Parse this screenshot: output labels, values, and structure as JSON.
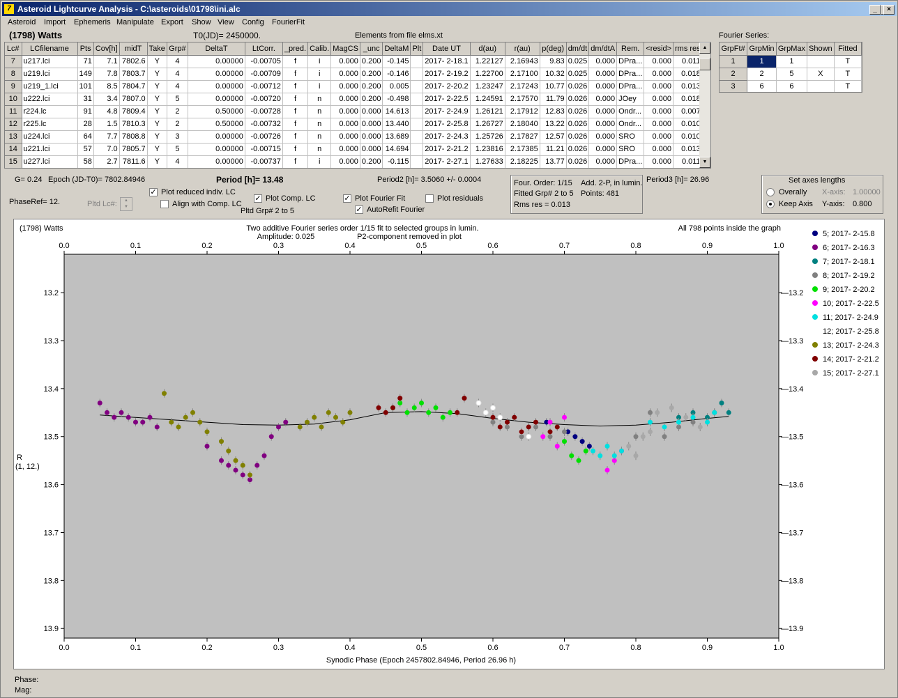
{
  "window": {
    "title": "Asteroid Lightcurve Analysis - C:\\asteroids\\01798\\ini.alc",
    "icon_glyph": "7"
  },
  "menu": [
    "Asteroid",
    "Import",
    "Ephemeris",
    "Manipulate",
    "Export",
    "Show",
    "View",
    "Config",
    "FourierFit"
  ],
  "header": {
    "asteroid": "(1798) Watts",
    "t0": "T0(JD)= 2450000.",
    "elements": "Elements from file elms.xt",
    "fourier_series": "Fourier Series:"
  },
  "lc_table": {
    "columns": [
      "Lc#",
      "LCfilename",
      "Pts",
      "Cov[h]",
      "midT",
      "Take",
      "Grp#",
      "DeltaT",
      "LtCorr.",
      "_pred.",
      "Calib.",
      "MagCS",
      "_unc",
      "DeltaM",
      "Plt",
      "Date UT",
      "d(au)",
      "r(au)",
      "p(deg)",
      "dm/dt",
      "dm/dtA",
      "Rem.",
      "<resid>",
      "rms res"
    ],
    "rows": [
      [
        "7",
        "u217.lci",
        "71",
        "7.1",
        "7802.6",
        "Y",
        "4",
        "0.00000",
        "-0.00705",
        "f",
        "i",
        "0.000",
        "0.200",
        "-0.145",
        "",
        "2017- 2-18.1",
        "1.22127",
        "2.16943",
        "9.83",
        "0.025",
        "0.000",
        "DPra...",
        "0.000",
        "0.011"
      ],
      [
        "8",
        "u219.lci",
        "149",
        "7.8",
        "7803.7",
        "Y",
        "4",
        "0.00000",
        "-0.00709",
        "f",
        "i",
        "0.000",
        "0.200",
        "-0.146",
        "",
        "2017- 2-19.2",
        "1.22700",
        "2.17100",
        "10.32",
        "0.025",
        "0.000",
        "DPra...",
        "0.000",
        "0.018"
      ],
      [
        "9",
        "u219_1.lci",
        "101",
        "8.5",
        "7804.7",
        "Y",
        "4",
        "0.00000",
        "-0.00712",
        "f",
        "i",
        "0.000",
        "0.200",
        "0.005",
        "",
        "2017- 2-20.2",
        "1.23247",
        "2.17243",
        "10.77",
        "0.026",
        "0.000",
        "DPra...",
        "0.000",
        "0.013"
      ],
      [
        "10",
        "u222.lci",
        "31",
        "3.4",
        "7807.0",
        "Y",
        "5",
        "0.00000",
        "-0.00720",
        "f",
        "n",
        "0.000",
        "0.200",
        "-0.498",
        "",
        "2017- 2-22.5",
        "1.24591",
        "2.17570",
        "11.79",
        "0.026",
        "0.000",
        "JOey",
        "0.000",
        "0.018"
      ],
      [
        "11",
        "r224.lc",
        "91",
        "4.8",
        "7809.4",
        "Y",
        "2",
        "0.50000",
        "-0.00728",
        "f",
        "n",
        "0.000",
        "0.000",
        "14.613",
        "",
        "2017- 2-24.9",
        "1.26121",
        "2.17912",
        "12.83",
        "0.026",
        "0.000",
        "Ondr...",
        "0.000",
        "0.007"
      ],
      [
        "12",
        "r225.lc",
        "28",
        "1.5",
        "7810.3",
        "Y",
        "2",
        "0.50000",
        "-0.00732",
        "f",
        "n",
        "0.000",
        "0.000",
        "13.440",
        "",
        "2017- 2-25.8",
        "1.26727",
        "2.18040",
        "13.22",
        "0.026",
        "0.000",
        "Ondr...",
        "0.000",
        "0.010"
      ],
      [
        "13",
        "u224.lci",
        "64",
        "7.7",
        "7808.8",
        "Y",
        "3",
        "0.00000",
        "-0.00726",
        "f",
        "n",
        "0.000",
        "0.000",
        "13.689",
        "",
        "2017- 2-24.3",
        "1.25726",
        "2.17827",
        "12.57",
        "0.026",
        "0.000",
        "SRO",
        "0.000",
        "0.010"
      ],
      [
        "14",
        "u221.lci",
        "57",
        "7.0",
        "7805.7",
        "Y",
        "5",
        "0.00000",
        "-0.00715",
        "f",
        "n",
        "0.000",
        "0.000",
        "14.694",
        "",
        "2017- 2-21.2",
        "1.23816",
        "2.17385",
        "11.21",
        "0.026",
        "0.000",
        "SRO",
        "0.000",
        "0.013"
      ],
      [
        "15",
        "u227.lci",
        "58",
        "2.7",
        "7811.6",
        "Y",
        "4",
        "0.00000",
        "-0.00737",
        "f",
        "i",
        "0.000",
        "0.200",
        "-0.115",
        "",
        "2017- 2-27.1",
        "1.27633",
        "2.18225",
        "13.77",
        "0.026",
        "0.000",
        "DPra...",
        "0.000",
        "0.011"
      ]
    ]
  },
  "fourier_table": {
    "columns": [
      "GrpFt#",
      "GrpMin",
      "GrpMax",
      "Shown",
      "Fitted"
    ],
    "rows": [
      [
        "1",
        "1",
        "1",
        "",
        "T"
      ],
      [
        "2",
        "2",
        "5",
        "X",
        "T"
      ],
      [
        "3",
        "6",
        "6",
        "",
        "T"
      ]
    ]
  },
  "controls": {
    "g": "G= 0.24",
    "epoch": "Epoch (JD-T0)= 7802.84946",
    "period": "Period [h]= 13.48",
    "period2": "Period2 [h]= 3.5060 +/- 0.0004",
    "period3": "Period3 [h]= 26.96",
    "phaseref": "PhaseRef= 12.",
    "pltd_lc": "Pltd Lc#:",
    "plot_reduced": "Plot reduced indiv. LC",
    "align_comp": "Align with Comp. LC",
    "plot_comp": "Plot Comp. LC",
    "pltd_grp": "Pltd Grp#  2   to   5",
    "plot_fourier": "Plot Fourier Fit",
    "autorefit": "AutoRefit Fourier",
    "plot_residuals": "Plot residuals",
    "info_order": "Four. Order:  1/15",
    "info_add": "Add. 2-P, in lumin.",
    "info_fitted": "Fitted Grp# 2 to 5",
    "info_points": "Points: 481",
    "info_rms": "Rms res      = 0.013",
    "axes_title": "Set axes lengths",
    "overally": "Overally",
    "keep_axis": "Keep Axis",
    "xaxis_label": "X-axis:",
    "xaxis_val": "1.00000",
    "yaxis_label": "Y-axis:",
    "yaxis_val": "0.800"
  },
  "plot": {
    "name": "(1798) Watts",
    "title1": "Two additive Fourier series order 1/15 fit to selected groups in lumin.",
    "title2a": "Amplitude: 0.025",
    "title2b": "P2-component removed in plot",
    "points_note": "All 798 points inside the graph",
    "ylabel1": "R",
    "ylabel2": "(1, 12.)",
    "xlabel": "Synodic Phase (Epoch 2457802.84946, Period 26.96 h)"
  },
  "chart_data": {
    "type": "scatter",
    "xlim": [
      0.0,
      1.0
    ],
    "ylim": [
      13.9,
      13.1
    ],
    "xticks": [
      "0.0",
      "0.1",
      "0.2",
      "0.3",
      "0.4",
      "0.5",
      "0.6",
      "0.7",
      "0.8",
      "0.9",
      "1.0"
    ],
    "yticks": [
      "13.2",
      "13.3",
      "13.4",
      "13.5",
      "13.6",
      "13.7",
      "13.8",
      "13.9"
    ],
    "xlabel": "Synodic Phase (Epoch 2457802.84946, Period 26.96 h)",
    "ylabel": "R",
    "legend_position": "right",
    "series": [
      {
        "name": "5; 2017- 2-15.8",
        "color": "#000080",
        "x": [
          0.675,
          0.705,
          0.715,
          0.725,
          0.735
        ],
        "y": [
          13.47,
          13.49,
          13.5,
          13.51,
          13.52
        ]
      },
      {
        "name": "6; 2017- 2-16.3",
        "color": "#800080",
        "x": [
          0.05,
          0.06,
          0.07,
          0.08,
          0.09,
          0.1,
          0.11,
          0.12,
          0.13,
          0.2,
          0.22,
          0.23,
          0.24,
          0.25,
          0.26,
          0.27,
          0.28,
          0.29,
          0.3,
          0.31
        ],
        "y": [
          13.43,
          13.45,
          13.46,
          13.45,
          13.46,
          13.47,
          13.47,
          13.46,
          13.48,
          13.52,
          13.55,
          13.56,
          13.57,
          13.58,
          13.59,
          13.56,
          13.54,
          13.5,
          13.48,
          13.47
        ]
      },
      {
        "name": "7; 2017- 2-18.1",
        "color": "#008080",
        "x": [
          0.86,
          0.88,
          0.9,
          0.91,
          0.92,
          0.93
        ],
        "y": [
          13.46,
          13.45,
          13.46,
          13.45,
          13.43,
          13.45
        ]
      },
      {
        "name": "8; 2017- 2-19.2",
        "color": "#808080",
        "x": [
          0.6,
          0.62,
          0.64,
          0.66,
          0.68,
          0.7,
          0.78,
          0.8,
          0.82,
          0.84,
          0.86,
          0.88
        ],
        "y": [
          13.47,
          13.48,
          13.5,
          13.48,
          13.5,
          13.49,
          13.53,
          13.5,
          13.45,
          13.5,
          13.48,
          13.47
        ]
      },
      {
        "name": "9; 2017- 2-20.2",
        "color": "#00e000",
        "x": [
          0.46,
          0.47,
          0.48,
          0.49,
          0.5,
          0.51,
          0.52,
          0.53,
          0.54,
          0.7,
          0.71,
          0.72,
          0.73
        ],
        "y": [
          13.44,
          13.43,
          13.45,
          13.44,
          13.43,
          13.45,
          13.44,
          13.46,
          13.45,
          13.51,
          13.54,
          13.55,
          13.53
        ]
      },
      {
        "name": "10; 2017- 2-22.5",
        "color": "#ff00ff",
        "x": [
          0.67,
          0.68,
          0.69,
          0.7,
          0.76,
          0.77,
          0.78
        ],
        "y": [
          13.5,
          13.47,
          13.52,
          13.46,
          13.57,
          13.55,
          13.53
        ]
      },
      {
        "name": "11; 2017- 2-24.9",
        "color": "#00e0e0",
        "x": [
          0.74,
          0.75,
          0.76,
          0.77,
          0.78,
          0.82,
          0.84,
          0.86,
          0.88,
          0.9,
          0.91
        ],
        "y": [
          13.53,
          13.54,
          13.52,
          13.54,
          13.53,
          13.47,
          13.48,
          13.47,
          13.46,
          13.47,
          13.45
        ]
      },
      {
        "name": "12; 2017- 2-25.8",
        "color": "#ffffff",
        "x": [
          0.58,
          0.59,
          0.6,
          0.61,
          0.64,
          0.65
        ],
        "y": [
          13.43,
          13.45,
          13.44,
          13.46,
          13.49,
          13.5
        ]
      },
      {
        "name": "13; 2017- 2-24.3",
        "color": "#808000",
        "x": [
          0.14,
          0.15,
          0.16,
          0.17,
          0.18,
          0.19,
          0.2,
          0.22,
          0.23,
          0.24,
          0.25,
          0.26,
          0.33,
          0.34,
          0.35,
          0.36,
          0.37,
          0.38,
          0.39,
          0.4
        ],
        "y": [
          13.41,
          13.47,
          13.48,
          13.46,
          13.45,
          13.47,
          13.49,
          13.51,
          13.53,
          13.55,
          13.56,
          13.58,
          13.48,
          13.47,
          13.46,
          13.48,
          13.45,
          13.46,
          13.47,
          13.45
        ]
      },
      {
        "name": "14; 2017- 2-21.2",
        "color": "#800000",
        "x": [
          0.44,
          0.45,
          0.46,
          0.47,
          0.55,
          0.56,
          0.6,
          0.61,
          0.62,
          0.63,
          0.64,
          0.65,
          0.66,
          0.68,
          0.69
        ],
        "y": [
          13.44,
          13.45,
          13.44,
          13.42,
          13.45,
          13.42,
          13.46,
          13.48,
          13.47,
          13.46,
          13.49,
          13.48,
          13.47,
          13.49,
          13.48
        ]
      },
      {
        "name": "15; 2017- 2-27.1",
        "color": "#a8a8a8",
        "x": [
          0.79,
          0.8,
          0.81,
          0.82,
          0.83,
          0.85,
          0.87,
          0.89
        ],
        "y": [
          13.52,
          13.54,
          13.5,
          13.49,
          13.45,
          13.44,
          13.46,
          13.48
        ]
      }
    ],
    "fit_curve": {
      "x": [
        0.05,
        0.1,
        0.15,
        0.2,
        0.25,
        0.3,
        0.35,
        0.4,
        0.45,
        0.5,
        0.55,
        0.6,
        0.65,
        0.7,
        0.75,
        0.8,
        0.85,
        0.9,
        0.93
      ],
      "y": [
        13.455,
        13.46,
        13.465,
        13.47,
        13.475,
        13.476,
        13.474,
        13.465,
        13.45,
        13.448,
        13.452,
        13.462,
        13.47,
        13.475,
        13.478,
        13.476,
        13.47,
        13.462,
        13.458
      ]
    }
  },
  "status": {
    "phase": "Phase:",
    "mag": "Mag:"
  }
}
